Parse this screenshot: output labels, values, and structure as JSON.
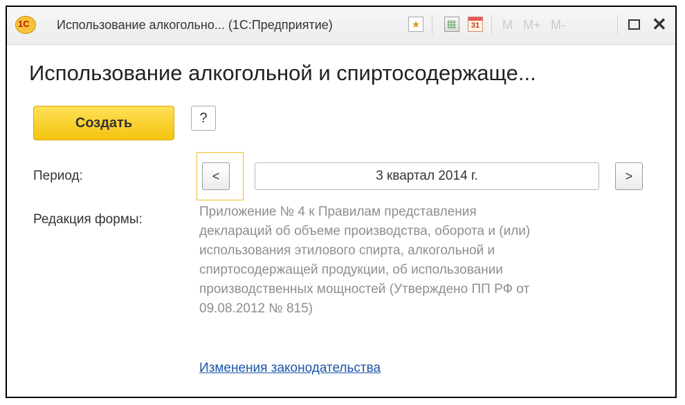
{
  "window": {
    "title": "Использование алкогольно... (1С:Предприятие)",
    "logo_text": "1С",
    "icons": [
      "star-favorite-icon",
      "calculator-icon",
      "calendar-icon",
      "maximize-icon",
      "close-icon"
    ],
    "calendar_day": "31",
    "memory_buttons": [
      "M",
      "M+",
      "M-"
    ],
    "close_glyph": "✕"
  },
  "form": {
    "title": "Использование алкогольной и спиртосодержаще...",
    "create_label": "Создать",
    "help_label": "?",
    "period_label": "Период:",
    "period_value": "3 квартал 2014 г.",
    "prev_glyph": "<",
    "next_glyph": ">",
    "edition_label": "Редакция формы:",
    "edition_lines": [
      "Приложение № 4 к Правилам представления",
      "деклараций об объеме производства, оборота и (или)",
      "использования этилового спирта, алкогольной и",
      "спиртосодержащей продукции, об использовании",
      "производственных мощностей (Утверждено ПП РФ от",
      "09.08.2012 № 815)"
    ],
    "law_link": "Изменения законодательства"
  },
  "colors": {
    "create_button": "#f5c40f",
    "link": "#1a55a8",
    "focus_border": "#f0c020"
  }
}
